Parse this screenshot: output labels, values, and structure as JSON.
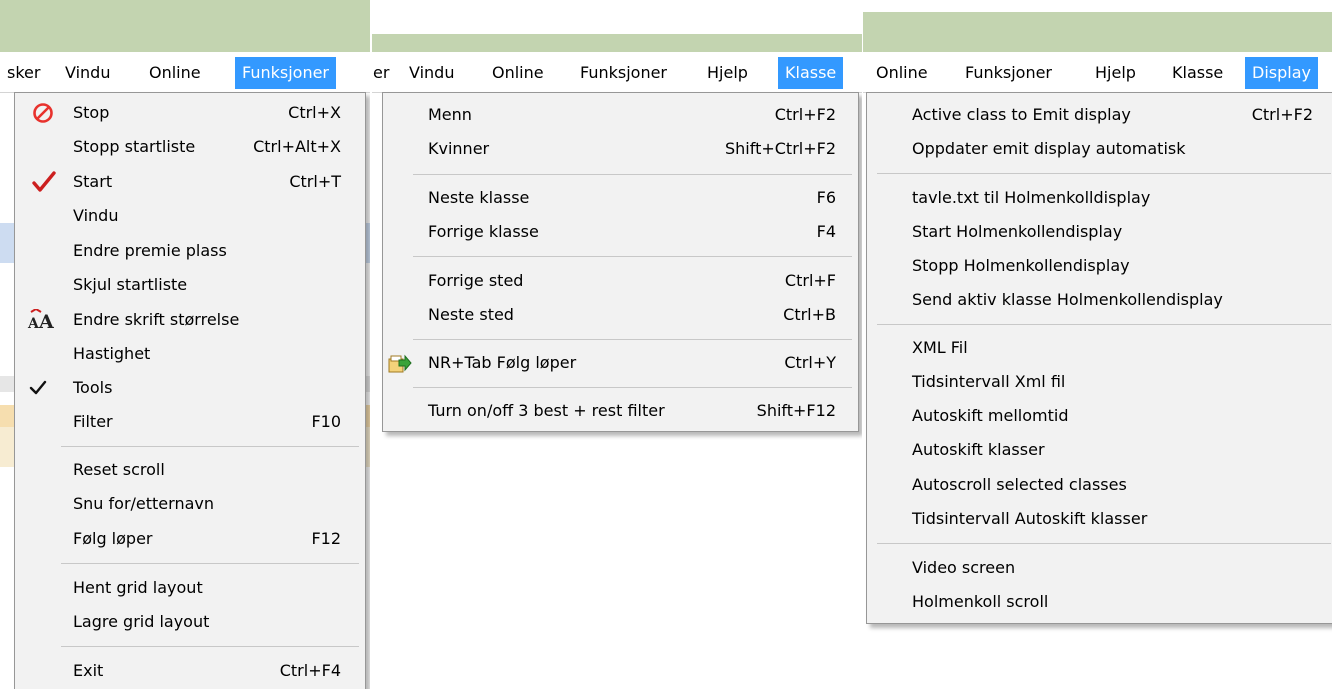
{
  "panel1": {
    "menubar": [
      "sker",
      "Vindu",
      "Online",
      "Funksjoner"
    ],
    "active_menu": "Funksjoner",
    "items": [
      {
        "label": "Stop",
        "shortcut": "Ctrl+X",
        "icon": "stop-icon"
      },
      {
        "label": "Stopp startliste",
        "shortcut": "Ctrl+Alt+X"
      },
      {
        "label": "Start",
        "shortcut": "Ctrl+T",
        "icon": "red-checkmark-icon"
      },
      {
        "label": "Vindu",
        "shortcut": ""
      },
      {
        "label": "Endre premie plass",
        "shortcut": ""
      },
      {
        "label": "Skjul startliste",
        "shortcut": ""
      },
      {
        "label": "Endre skrift størrelse",
        "shortcut": "",
        "icon": "font-size-icon"
      },
      {
        "label": "Hastighet",
        "shortcut": ""
      },
      {
        "label": "Tools",
        "shortcut": "",
        "icon": "checkmark-icon",
        "checked": true
      },
      {
        "label": "Filter",
        "shortcut": "F10"
      },
      {
        "label": "Reset scroll",
        "shortcut": ""
      },
      {
        "label": "Snu for/etternavn",
        "shortcut": ""
      },
      {
        "label": "Følg løper",
        "shortcut": "F12"
      },
      {
        "label": "Hent grid layout",
        "shortcut": ""
      },
      {
        "label": "Lagre grid layout",
        "shortcut": ""
      },
      {
        "label": "Exit",
        "shortcut": "Ctrl+F4"
      }
    ]
  },
  "panel2": {
    "menubar": [
      "er",
      "Vindu",
      "Online",
      "Funksjoner",
      "Hjelp",
      "Klasse"
    ],
    "active_menu": "Klasse",
    "items": [
      {
        "label": "Menn",
        "shortcut": "Ctrl+F2"
      },
      {
        "label": "Kvinner",
        "shortcut": "Shift+Ctrl+F2"
      },
      {
        "label": "Neste klasse",
        "shortcut": "F6"
      },
      {
        "label": "Forrige klasse",
        "shortcut": "F4"
      },
      {
        "label": "Forrige sted",
        "shortcut": "Ctrl+F"
      },
      {
        "label": "Neste sted",
        "shortcut": "Ctrl+B"
      },
      {
        "label": "NR+Tab Følg løper",
        "shortcut": "Ctrl+Y",
        "icon": "follow-runner-icon"
      },
      {
        "label": "Turn on/off 3 best + rest filter",
        "shortcut": "Shift+F12"
      }
    ]
  },
  "panel3": {
    "menubar": [
      "Online",
      "Funksjoner",
      "Hjelp",
      "Klasse",
      "Display"
    ],
    "active_menu": "Display",
    "items": [
      {
        "label": "Active class to Emit display",
        "shortcut": "Ctrl+F2"
      },
      {
        "label": "Oppdater emit display automatisk",
        "shortcut": ""
      },
      {
        "label": "tavle.txt til Holmenkolldisplay",
        "shortcut": ""
      },
      {
        "label": "Start Holmenkollendisplay",
        "shortcut": ""
      },
      {
        "label": "Stopp Holmenkollendisplay",
        "shortcut": ""
      },
      {
        "label": "Send aktiv klasse Holmenkollendisplay",
        "shortcut": ""
      },
      {
        "label": "XML Fil",
        "shortcut": ""
      },
      {
        "label": "Tidsintervall Xml fil",
        "shortcut": ""
      },
      {
        "label": "Autoskift mellomtid",
        "shortcut": ""
      },
      {
        "label": "Autoskift klasser",
        "shortcut": ""
      },
      {
        "label": "Autoscroll selected classes",
        "shortcut": ""
      },
      {
        "label": "Tidsintervall Autoskift klasser",
        "shortcut": ""
      },
      {
        "label": "Video screen",
        "shortcut": ""
      },
      {
        "label": "Holmenkoll scroll",
        "shortcut": ""
      }
    ]
  },
  "colors": {
    "title_bar": "#c3d4b0",
    "menu_bg": "#f2f2f2",
    "active_menu_bg": "#3399ff",
    "active_menu_text": "#ffffff",
    "stop_icon": "#e8322d",
    "check_icon": "#cc1f1f"
  }
}
